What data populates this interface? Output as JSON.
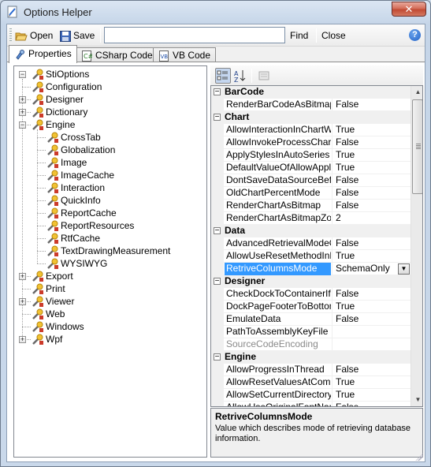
{
  "window": {
    "title": "Options Helper",
    "close_glyph": "✕"
  },
  "toolbar": {
    "open_label": "Open",
    "save_label": "Save",
    "find_value": "",
    "find_label": "Find",
    "close_label": "Close",
    "help_glyph": "?"
  },
  "tabs": [
    {
      "label": "Properties",
      "icon": "properties-icon",
      "active": true
    },
    {
      "label": "CSharp Code",
      "icon": "csharp-file-icon",
      "active": false
    },
    {
      "label": "VB Code",
      "icon": "vb-file-icon",
      "active": false
    }
  ],
  "tree": {
    "root": "StiOptions",
    "items": [
      {
        "label": "Configuration",
        "level": 1,
        "expander": ""
      },
      {
        "label": "Designer",
        "level": 1,
        "expander": "+"
      },
      {
        "label": "Dictionary",
        "level": 1,
        "expander": "+"
      },
      {
        "label": "Engine",
        "level": 1,
        "expander": "−"
      },
      {
        "label": "CrossTab",
        "level": 2,
        "expander": ""
      },
      {
        "label": "Globalization",
        "level": 2,
        "expander": ""
      },
      {
        "label": "Image",
        "level": 2,
        "expander": ""
      },
      {
        "label": "ImageCache",
        "level": 2,
        "expander": ""
      },
      {
        "label": "Interaction",
        "level": 2,
        "expander": ""
      },
      {
        "label": "QuickInfo",
        "level": 2,
        "expander": ""
      },
      {
        "label": "ReportCache",
        "level": 2,
        "expander": ""
      },
      {
        "label": "ReportResources",
        "level": 2,
        "expander": ""
      },
      {
        "label": "RtfCache",
        "level": 2,
        "expander": ""
      },
      {
        "label": "TextDrawingMeasurement",
        "level": 2,
        "expander": ""
      },
      {
        "label": "WYSIWYG",
        "level": 2,
        "expander": ""
      },
      {
        "label": "Export",
        "level": 1,
        "expander": "+"
      },
      {
        "label": "Print",
        "level": 1,
        "expander": ""
      },
      {
        "label": "Viewer",
        "level": 1,
        "expander": "+"
      },
      {
        "label": "Web",
        "level": 1,
        "expander": ""
      },
      {
        "label": "Windows",
        "level": 1,
        "expander": ""
      },
      {
        "label": "Wpf",
        "level": 1,
        "expander": "+"
      }
    ]
  },
  "property_grid": {
    "rows": [
      {
        "type": "cat",
        "name": "BarCode",
        "toggle": "−"
      },
      {
        "type": "prop",
        "name": "RenderBarCodeAsBitmap",
        "value": "False"
      },
      {
        "type": "cat",
        "name": "Chart",
        "toggle": "−"
      },
      {
        "type": "prop",
        "name": "AllowInteractionInChartWithComponents",
        "value": "True"
      },
      {
        "type": "prop",
        "name": "AllowInvokeProcessChartEvent",
        "value": "False"
      },
      {
        "type": "prop",
        "name": "ApplyStylesInAutoSeries",
        "value": "True"
      },
      {
        "type": "prop",
        "name": "DefaultValueOfAllowApplyStyle",
        "value": "True"
      },
      {
        "type": "prop",
        "name": "DontSaveDataSourceBeforeChartRendering",
        "value": "False"
      },
      {
        "type": "prop",
        "name": "OldChartPercentMode",
        "value": "False"
      },
      {
        "type": "prop",
        "name": "RenderChartAsBitmap",
        "value": "False"
      },
      {
        "type": "prop",
        "name": "RenderChartAsBitmapZoom",
        "value": "2"
      },
      {
        "type": "cat",
        "name": "Data",
        "toggle": "−"
      },
      {
        "type": "prop",
        "name": "AdvancedRetrievalModeOfDatabaseSchema",
        "value": "False"
      },
      {
        "type": "prop",
        "name": "AllowUseResetMethodInBusinessObject",
        "value": "True"
      },
      {
        "type": "prop",
        "name": "RetriveColumnsMode",
        "value": "SchemaOnly",
        "selected": true,
        "dropdown": true
      },
      {
        "type": "cat",
        "name": "Designer",
        "toggle": "−"
      },
      {
        "type": "prop",
        "name": "CheckDockToContainerIfComponentMoving",
        "value": "False"
      },
      {
        "type": "prop",
        "name": "DockPageFooterToBottom",
        "value": "True"
      },
      {
        "type": "prop",
        "name": "EmulateData",
        "value": "False"
      },
      {
        "type": "prop",
        "name": "PathToAssemblyKeyFile",
        "value": ""
      },
      {
        "type": "prop",
        "name": "SourceCodeEncoding",
        "value": "",
        "disabled": true
      },
      {
        "type": "cat",
        "name": "Engine",
        "toggle": "−"
      },
      {
        "type": "prop",
        "name": "AllowProgressInThread",
        "value": "False"
      },
      {
        "type": "prop",
        "name": "AllowResetValuesAtComponent",
        "value": "True"
      },
      {
        "type": "prop",
        "name": "AllowSetCurrentDirectory",
        "value": "True"
      },
      {
        "type": "prop",
        "name": "AllowUseOriginalFontName",
        "value": "False"
      }
    ],
    "help_title": "RetriveColumnsMode",
    "help_description": "Value which describes mode of retrieving database information."
  },
  "colors": {
    "selection": "#3399ff",
    "category_bg": "#f0f0f0"
  }
}
